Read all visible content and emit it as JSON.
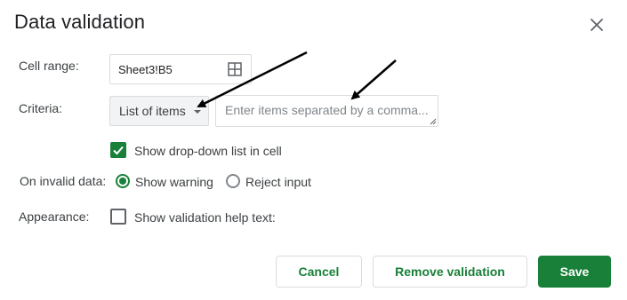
{
  "dialog": {
    "title": "Data validation",
    "close_icon": "close-icon"
  },
  "cell_range": {
    "label": "Cell range:",
    "value": "Sheet3!B5",
    "icon": "grid-select-icon"
  },
  "criteria": {
    "label": "Criteria:",
    "selected": "List of items",
    "items_value": "",
    "items_placeholder": "Enter items separated by a comma..."
  },
  "show_dropdown": {
    "label": "Show drop-down list in cell",
    "checked": true
  },
  "invalid_data": {
    "label": "On invalid data:",
    "options": [
      {
        "label": "Show warning",
        "selected": true
      },
      {
        "label": "Reject input",
        "selected": false
      }
    ]
  },
  "appearance": {
    "label": "Appearance:",
    "help_text_label": "Show validation help text:",
    "checked": false
  },
  "buttons": {
    "cancel": "Cancel",
    "remove": "Remove validation",
    "save": "Save"
  },
  "colors": {
    "accent": "#188038",
    "text": "#202124",
    "border": "#dadce0"
  }
}
